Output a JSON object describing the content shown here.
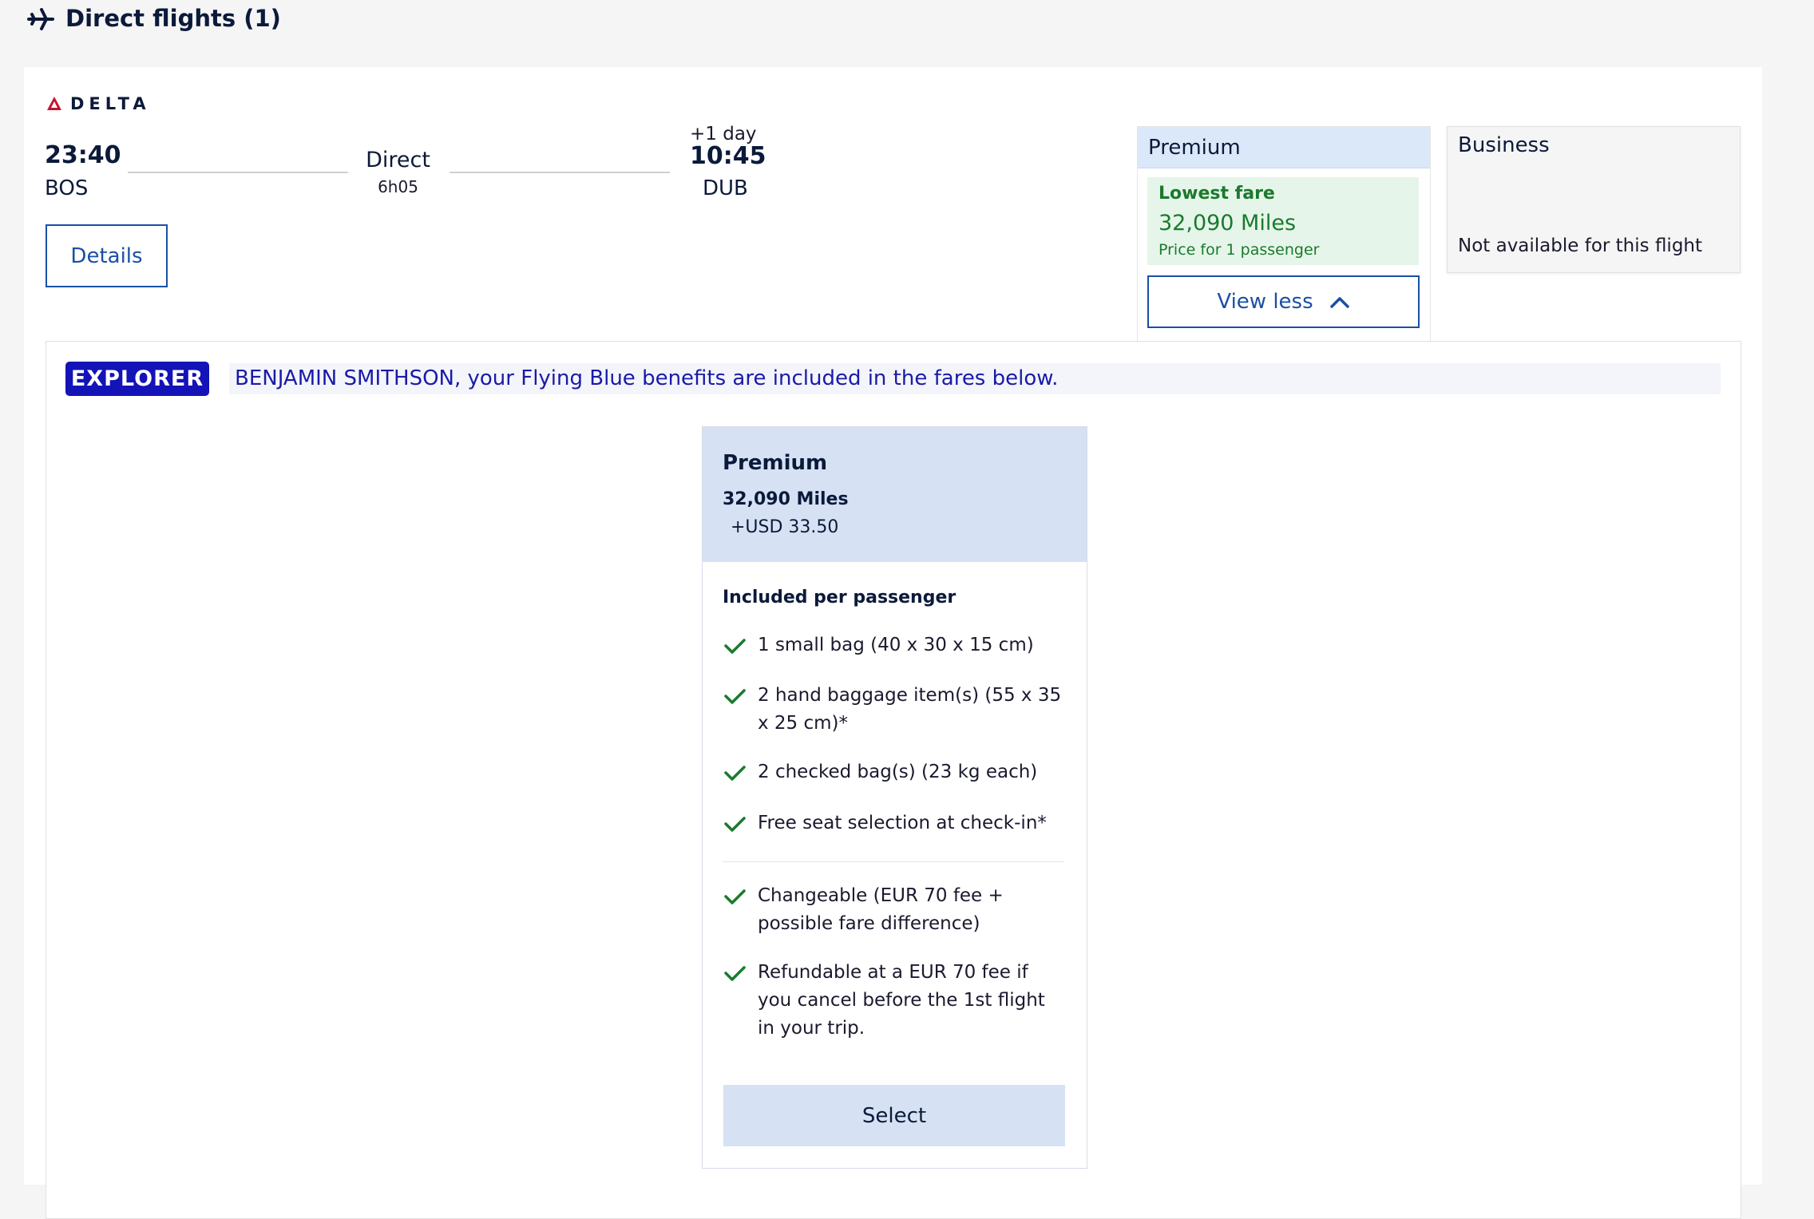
{
  "header": {
    "title": "Direct flights (1)",
    "icon": "airplane-icon"
  },
  "flight": {
    "airline": "DELTA",
    "departure_time": "23:40",
    "departure_airport": "BOS",
    "stops": "Direct",
    "duration": "6h05",
    "day_offset": "+1 day",
    "arrival_time": "10:45",
    "arrival_airport": "DUB",
    "details_label": "Details"
  },
  "fares": {
    "premium": {
      "cabin": "Premium",
      "lowest_label": "Lowest fare",
      "price": "32,090 Miles",
      "note": "Price for 1 passenger",
      "toggle_label": "View less"
    },
    "business": {
      "cabin": "Business",
      "status": "Not available for this flight"
    }
  },
  "benefits": {
    "tier": "EXPLORER",
    "message": "BENJAMIN SMITHSON, your Flying Blue benefits are included in the fares below."
  },
  "fare_detail": {
    "name": "Premium",
    "miles": "32,090 Miles",
    "taxes": "+USD 33.50",
    "included_label": "Included per passenger",
    "baggage": [
      "1 small bag (40 x 30 x 15 cm)",
      "2 hand baggage item(s) (55 x 35 x 25 cm)*",
      "2 checked bag(s) (23 kg each)",
      "Free seat selection at check-in*"
    ],
    "conditions": [
      "Changeable (EUR 70 fee + possible fare difference)",
      "Refundable at a EUR 70 fee if you cancel before the 1st flight in your trip."
    ],
    "select_label": "Select"
  },
  "colors": {
    "brand_blue": "#1a4fa6",
    "explorer_badge": "#1313b8",
    "success_green": "#1a7a2e",
    "premium_header": "#dbe8fa",
    "select_bg": "#d6e2f3"
  }
}
